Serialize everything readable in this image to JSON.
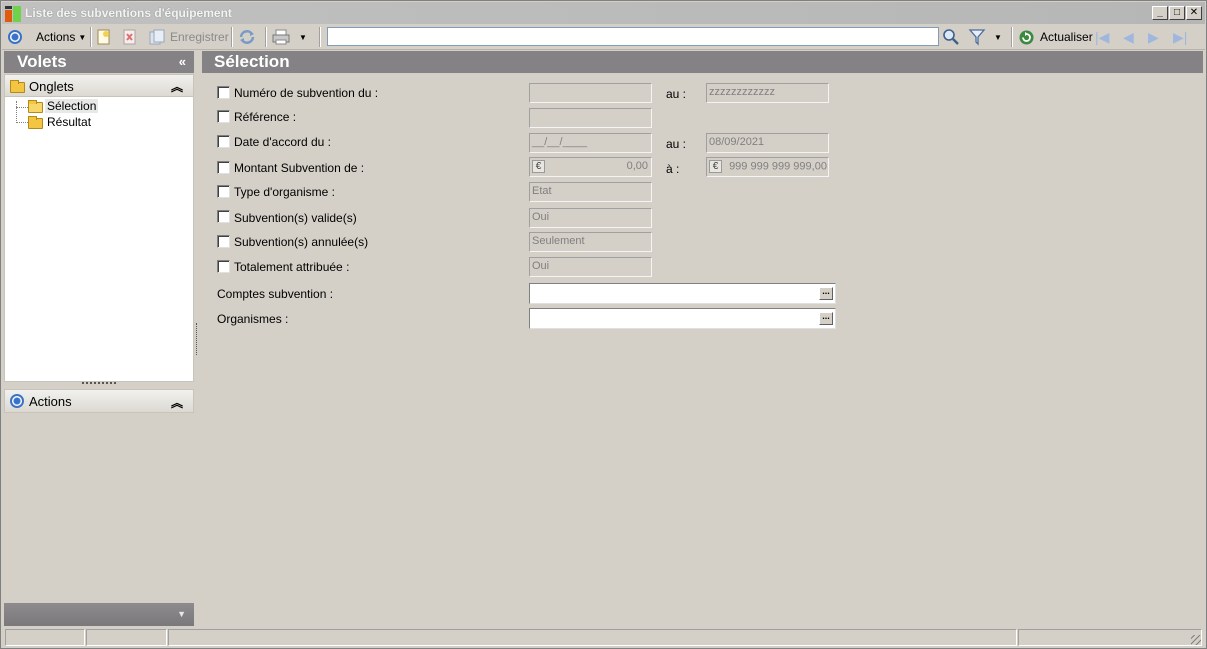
{
  "window": {
    "title": "Liste des subventions d'équipement",
    "controls": {
      "minimize": "_",
      "maximize": "□",
      "close": "✕"
    }
  },
  "toolbar": {
    "actions_label": "Actions",
    "save_label": "Enregistrer",
    "search_value": "",
    "refresh_label": "Actualiser"
  },
  "left_panel": {
    "title": "Volets",
    "collapse_glyph": "«",
    "onglets": {
      "label": "Onglets",
      "chevron": "⌃",
      "items": [
        {
          "label": "Sélection",
          "selected": true
        },
        {
          "label": "Résultat",
          "selected": false
        }
      ]
    },
    "actions": {
      "label": "Actions",
      "chevron": "⌃"
    },
    "footer_glyph": "▼"
  },
  "main": {
    "title": "Sélection",
    "fields": {
      "numero": {
        "label": "Numéro de subvention du :",
        "from": "",
        "to_label": "au :",
        "to": "zzzzzzzzzzzz"
      },
      "reference": {
        "label": "Référence :",
        "value": ""
      },
      "date_accord": {
        "label": "Date d'accord du :",
        "from": "__/__/____",
        "to_label": "au :",
        "to": "08/09/2021"
      },
      "montant": {
        "label": "Montant Subvention de :",
        "currency": "€",
        "from": "0,00",
        "to_label": "à :",
        "to": "999 999 999 999,00"
      },
      "type_organisme": {
        "label": "Type d'organisme :",
        "value": "Etat"
      },
      "valide": {
        "label": "Subvention(s) valide(s)",
        "value": "Oui"
      },
      "annulee": {
        "label": "Subvention(s) annulée(s)",
        "value": "Seulement"
      },
      "totalement": {
        "label": "Totalement attribuée :",
        "value": "Oui"
      },
      "comptes": {
        "label": "Comptes subvention :",
        "value": "",
        "button": "..."
      },
      "organismes": {
        "label": "Organismes :",
        "value": "",
        "button": "..."
      }
    }
  },
  "colors": {
    "panel_header": "#848284",
    "background": "#d4d0c8",
    "accent_icon": "#3a72c8"
  }
}
